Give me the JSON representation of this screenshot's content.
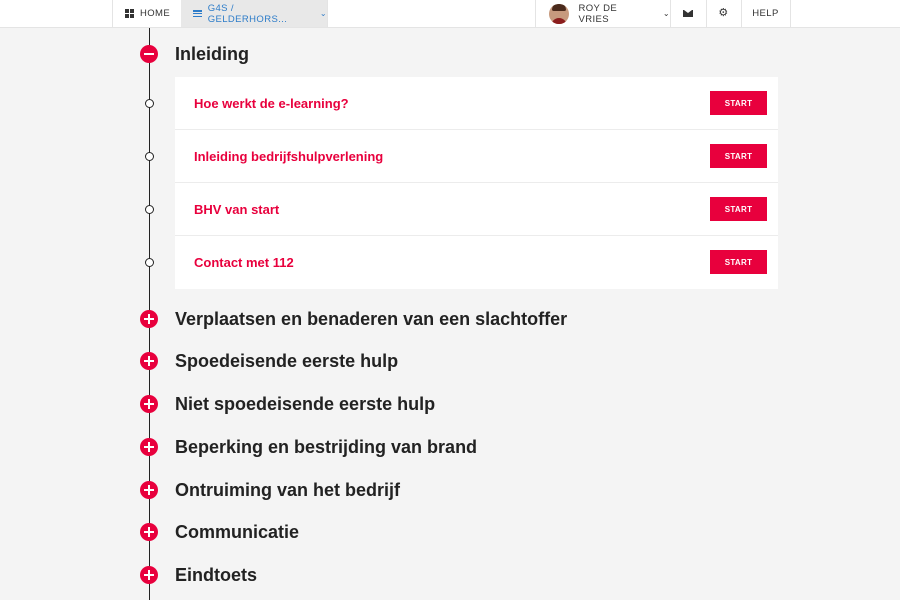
{
  "nav": {
    "home_label": "HOME",
    "org_label": "G4S / GELDERHORS...",
    "user_name": "ROY DE VRIES",
    "help_label": "HELP"
  },
  "colors": {
    "accent": "#e8003d",
    "link": "#2d7cc9"
  },
  "icons": [
    "grid-icon",
    "menu-icon",
    "chevron-down-icon",
    "envelope-icon",
    "gear-icon",
    "minus-icon",
    "plus-icon"
  ],
  "sections": [
    {
      "title": "Inleiding",
      "expanded": true
    },
    {
      "title": "Verplaatsen en benaderen van een slachtoffer",
      "expanded": false
    },
    {
      "title": "Spoedeisende eerste hulp",
      "expanded": false
    },
    {
      "title": "Niet spoedeisende eerste hulp",
      "expanded": false
    },
    {
      "title": "Beperking en bestrijding van brand",
      "expanded": false
    },
    {
      "title": "Ontruiming van het bedrijf",
      "expanded": false
    },
    {
      "title": "Communicatie",
      "expanded": false
    },
    {
      "title": "Eindtoets",
      "expanded": false
    }
  ],
  "lessons": [
    {
      "title": "Hoe werkt de e-learning?",
      "button": "START"
    },
    {
      "title": "Inleiding bedrijfshulpverlening",
      "button": "START"
    },
    {
      "title": "BHV van start",
      "button": "START"
    },
    {
      "title": "Contact met 112",
      "button": "START"
    }
  ]
}
